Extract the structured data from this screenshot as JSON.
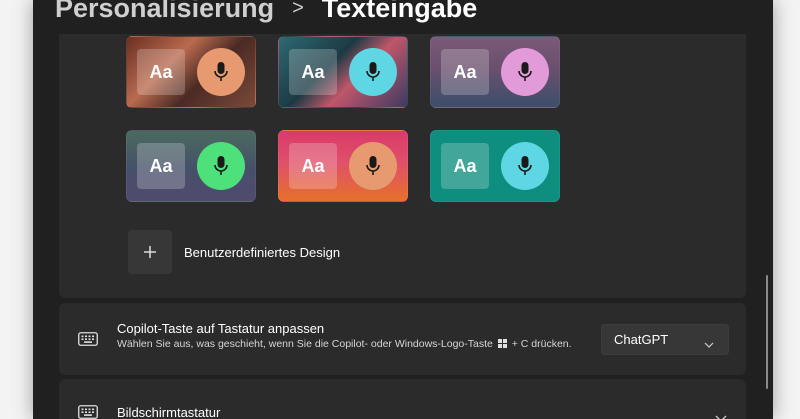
{
  "breadcrumb": {
    "parent": "Personalisierung",
    "separator": ">",
    "current": "Texteingabe"
  },
  "themes": {
    "tiles": [
      {
        "aa": "Aa",
        "mic_icon": "microphone-icon",
        "accent": "#e79a6f"
      },
      {
        "aa": "Aa",
        "mic_icon": "microphone-icon",
        "accent": "#5fd6e3"
      },
      {
        "aa": "Aa",
        "mic_icon": "microphone-icon",
        "accent": "#e39ad8"
      },
      {
        "aa": "Aa",
        "mic_icon": "microphone-icon",
        "accent": "#4ee07a"
      },
      {
        "aa": "Aa",
        "mic_icon": "microphone-icon",
        "accent": "#e79a6f"
      },
      {
        "aa": "Aa",
        "mic_icon": "microphone-icon",
        "accent": "#5fd6e3"
      }
    ],
    "custom_design_label": "Benutzerdefiniertes Design",
    "custom_design_icon": "plus-icon"
  },
  "copilot_key": {
    "icon": "keyboard-icon",
    "title": "Copilot-Taste auf Tastatur anpassen",
    "description_before": "Wählen Sie aus, was geschieht, wenn Sie die Copilot- oder Windows-Logo-Taste",
    "description_after": "+ C drücken.",
    "windows_icon": "windows-logo-icon",
    "selected_value": "ChatGPT"
  },
  "on_screen_keyboard": {
    "icon": "keyboard-icon",
    "title": "Bildschirmtastatur"
  },
  "colors": {
    "window_bg": "#202020",
    "card_bg": "#2b2b2b",
    "control_bg": "#373737"
  }
}
